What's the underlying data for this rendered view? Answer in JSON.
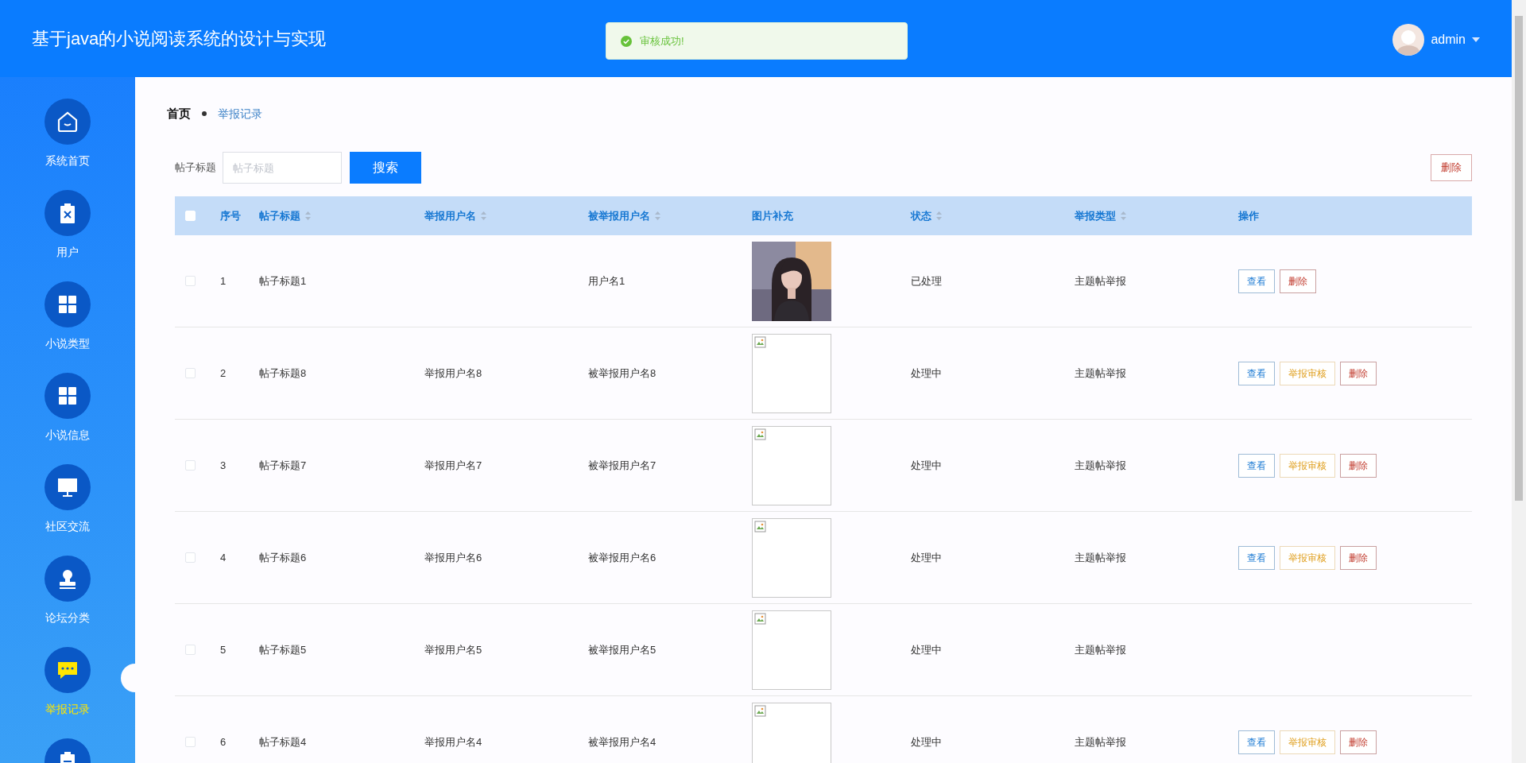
{
  "header": {
    "title": "基于java的小说阅读系统的设计与实现",
    "user": "admin"
  },
  "toast": {
    "text": "审核成功!"
  },
  "sidebar": {
    "items": [
      {
        "label": "系统首页",
        "kind": "home",
        "selected": false
      },
      {
        "label": "用户",
        "kind": "users",
        "selected": false
      },
      {
        "label": "小说类型",
        "kind": "types",
        "selected": false
      },
      {
        "label": "小说信息",
        "kind": "novels",
        "selected": false
      },
      {
        "label": "社区交流",
        "kind": "community",
        "selected": false
      },
      {
        "label": "论坛分类",
        "kind": "forum",
        "selected": false
      },
      {
        "label": "举报记录",
        "kind": "reports",
        "selected": true
      },
      {
        "kind": "more",
        "selected": false
      }
    ]
  },
  "breadcrumb": [
    {
      "label": "首页"
    },
    {
      "label": "举报记录"
    }
  ],
  "search": {
    "label": "帖子标题",
    "placeholder": "帖子标题",
    "button": "搜索"
  },
  "delete_button": "删除",
  "table": {
    "select_all": {
      "checked": false
    },
    "columns": [
      {
        "label": "序号",
        "sortable": false
      },
      {
        "label": "帖子标题",
        "sortable": true
      },
      {
        "label": "举报用户名",
        "sortable": true
      },
      {
        "label": "被举报用户名",
        "sortable": true
      },
      {
        "label": "图片补充",
        "sortable": false
      },
      {
        "label": "状态",
        "sortable": true
      },
      {
        "label": "举报类型",
        "sortable": true
      },
      {
        "label": "操作",
        "sortable": false
      }
    ],
    "rows": [
      {
        "checked": false,
        "index": "1",
        "title": "帖子标题1",
        "reported": "用户名1",
        "image": {
          "kind": "picture"
        },
        "status": "已处理",
        "type": "主题帖举报",
        "actions": [
          {
            "label": "查看",
            "kind": "view"
          },
          {
            "label": "删除",
            "kind": "delete"
          }
        ]
      },
      {
        "checked": false,
        "index": "2",
        "title": "帖子标题8",
        "reporter": "举报用户名8",
        "reported": "被举报用户名8",
        "image": {
          "kind": "missing"
        },
        "status": "处理中",
        "type": "主题帖举报",
        "actions": [
          {
            "label": "查看",
            "kind": "view"
          },
          {
            "label": "举报审核",
            "kind": "review"
          },
          {
            "label": "删除",
            "kind": "delete"
          }
        ]
      },
      {
        "checked": false,
        "index": "3",
        "title": "帖子标题7",
        "reporter": "举报用户名7",
        "reported": "被举报用户名7",
        "image": {
          "kind": "missing"
        },
        "status": "处理中",
        "type": "主题帖举报",
        "actions": [
          {
            "label": "查看",
            "kind": "view"
          },
          {
            "label": "举报审核",
            "kind": "review"
          },
          {
            "label": "删除",
            "kind": "delete"
          }
        ]
      },
      {
        "checked": false,
        "index": "4",
        "title": "帖子标题6",
        "reporter": "举报用户名6",
        "reported": "被举报用户名6",
        "image": {
          "kind": "missing"
        },
        "status": "处理中",
        "type": "主题帖举报",
        "actions": [
          {
            "label": "查看",
            "kind": "view"
          },
          {
            "label": "举报审核",
            "kind": "review"
          },
          {
            "label": "删除",
            "kind": "delete"
          }
        ]
      },
      {
        "checked": false,
        "index": "5",
        "title": "帖子标题5",
        "reporter": "举报用户名5",
        "reported": "被举报用户名5",
        "image": {
          "kind": "missing"
        },
        "status": "处理中",
        "type": "主题帖举报"
      },
      {
        "checked": false,
        "index": "6",
        "title": "帖子标题4",
        "reporter": "举报用户名4",
        "reported": "被举报用户名4",
        "image": {
          "kind": "missing"
        },
        "status": "处理中",
        "type": "主题帖举报",
        "actions": [
          {
            "label": "查看",
            "kind": "view"
          },
          {
            "label": "举报审核",
            "kind": "review"
          },
          {
            "label": "删除",
            "kind": "delete"
          }
        ]
      }
    ]
  }
}
